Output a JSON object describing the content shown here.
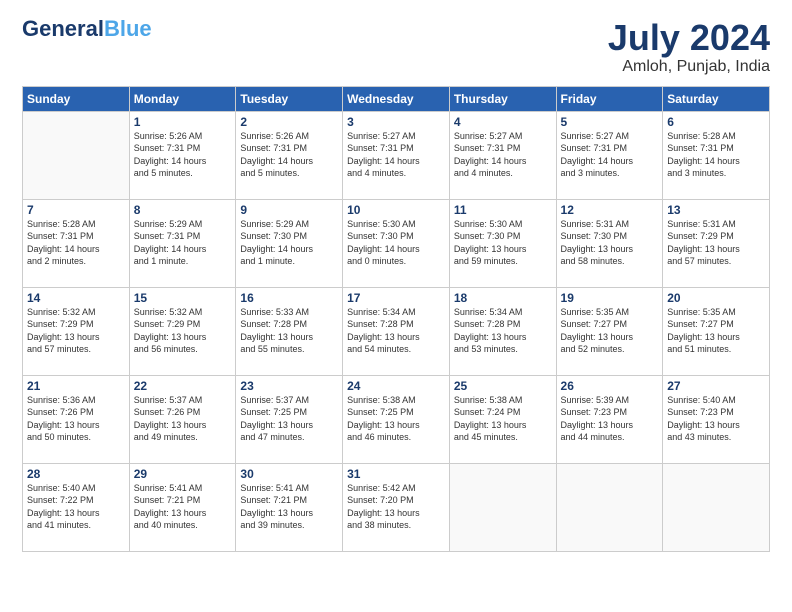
{
  "header": {
    "logo_line1": "General",
    "logo_highlight": "Blue",
    "month_year": "July 2024",
    "location": "Amloh, Punjab, India"
  },
  "days_of_week": [
    "Sunday",
    "Monday",
    "Tuesday",
    "Wednesday",
    "Thursday",
    "Friday",
    "Saturday"
  ],
  "weeks": [
    [
      {
        "day": "",
        "info": ""
      },
      {
        "day": "1",
        "info": "Sunrise: 5:26 AM\nSunset: 7:31 PM\nDaylight: 14 hours\nand 5 minutes."
      },
      {
        "day": "2",
        "info": "Sunrise: 5:26 AM\nSunset: 7:31 PM\nDaylight: 14 hours\nand 5 minutes."
      },
      {
        "day": "3",
        "info": "Sunrise: 5:27 AM\nSunset: 7:31 PM\nDaylight: 14 hours\nand 4 minutes."
      },
      {
        "day": "4",
        "info": "Sunrise: 5:27 AM\nSunset: 7:31 PM\nDaylight: 14 hours\nand 4 minutes."
      },
      {
        "day": "5",
        "info": "Sunrise: 5:27 AM\nSunset: 7:31 PM\nDaylight: 14 hours\nand 3 minutes."
      },
      {
        "day": "6",
        "info": "Sunrise: 5:28 AM\nSunset: 7:31 PM\nDaylight: 14 hours\nand 3 minutes."
      }
    ],
    [
      {
        "day": "7",
        "info": "Sunrise: 5:28 AM\nSunset: 7:31 PM\nDaylight: 14 hours\nand 2 minutes."
      },
      {
        "day": "8",
        "info": "Sunrise: 5:29 AM\nSunset: 7:31 PM\nDaylight: 14 hours\nand 1 minute."
      },
      {
        "day": "9",
        "info": "Sunrise: 5:29 AM\nSunset: 7:30 PM\nDaylight: 14 hours\nand 1 minute."
      },
      {
        "day": "10",
        "info": "Sunrise: 5:30 AM\nSunset: 7:30 PM\nDaylight: 14 hours\nand 0 minutes."
      },
      {
        "day": "11",
        "info": "Sunrise: 5:30 AM\nSunset: 7:30 PM\nDaylight: 13 hours\nand 59 minutes."
      },
      {
        "day": "12",
        "info": "Sunrise: 5:31 AM\nSunset: 7:30 PM\nDaylight: 13 hours\nand 58 minutes."
      },
      {
        "day": "13",
        "info": "Sunrise: 5:31 AM\nSunset: 7:29 PM\nDaylight: 13 hours\nand 57 minutes."
      }
    ],
    [
      {
        "day": "14",
        "info": "Sunrise: 5:32 AM\nSunset: 7:29 PM\nDaylight: 13 hours\nand 57 minutes."
      },
      {
        "day": "15",
        "info": "Sunrise: 5:32 AM\nSunset: 7:29 PM\nDaylight: 13 hours\nand 56 minutes."
      },
      {
        "day": "16",
        "info": "Sunrise: 5:33 AM\nSunset: 7:28 PM\nDaylight: 13 hours\nand 55 minutes."
      },
      {
        "day": "17",
        "info": "Sunrise: 5:34 AM\nSunset: 7:28 PM\nDaylight: 13 hours\nand 54 minutes."
      },
      {
        "day": "18",
        "info": "Sunrise: 5:34 AM\nSunset: 7:28 PM\nDaylight: 13 hours\nand 53 minutes."
      },
      {
        "day": "19",
        "info": "Sunrise: 5:35 AM\nSunset: 7:27 PM\nDaylight: 13 hours\nand 52 minutes."
      },
      {
        "day": "20",
        "info": "Sunrise: 5:35 AM\nSunset: 7:27 PM\nDaylight: 13 hours\nand 51 minutes."
      }
    ],
    [
      {
        "day": "21",
        "info": "Sunrise: 5:36 AM\nSunset: 7:26 PM\nDaylight: 13 hours\nand 50 minutes."
      },
      {
        "day": "22",
        "info": "Sunrise: 5:37 AM\nSunset: 7:26 PM\nDaylight: 13 hours\nand 49 minutes."
      },
      {
        "day": "23",
        "info": "Sunrise: 5:37 AM\nSunset: 7:25 PM\nDaylight: 13 hours\nand 47 minutes."
      },
      {
        "day": "24",
        "info": "Sunrise: 5:38 AM\nSunset: 7:25 PM\nDaylight: 13 hours\nand 46 minutes."
      },
      {
        "day": "25",
        "info": "Sunrise: 5:38 AM\nSunset: 7:24 PM\nDaylight: 13 hours\nand 45 minutes."
      },
      {
        "day": "26",
        "info": "Sunrise: 5:39 AM\nSunset: 7:23 PM\nDaylight: 13 hours\nand 44 minutes."
      },
      {
        "day": "27",
        "info": "Sunrise: 5:40 AM\nSunset: 7:23 PM\nDaylight: 13 hours\nand 43 minutes."
      }
    ],
    [
      {
        "day": "28",
        "info": "Sunrise: 5:40 AM\nSunset: 7:22 PM\nDaylight: 13 hours\nand 41 minutes."
      },
      {
        "day": "29",
        "info": "Sunrise: 5:41 AM\nSunset: 7:21 PM\nDaylight: 13 hours\nand 40 minutes."
      },
      {
        "day": "30",
        "info": "Sunrise: 5:41 AM\nSunset: 7:21 PM\nDaylight: 13 hours\nand 39 minutes."
      },
      {
        "day": "31",
        "info": "Sunrise: 5:42 AM\nSunset: 7:20 PM\nDaylight: 13 hours\nand 38 minutes."
      },
      {
        "day": "",
        "info": ""
      },
      {
        "day": "",
        "info": ""
      },
      {
        "day": "",
        "info": ""
      }
    ]
  ]
}
